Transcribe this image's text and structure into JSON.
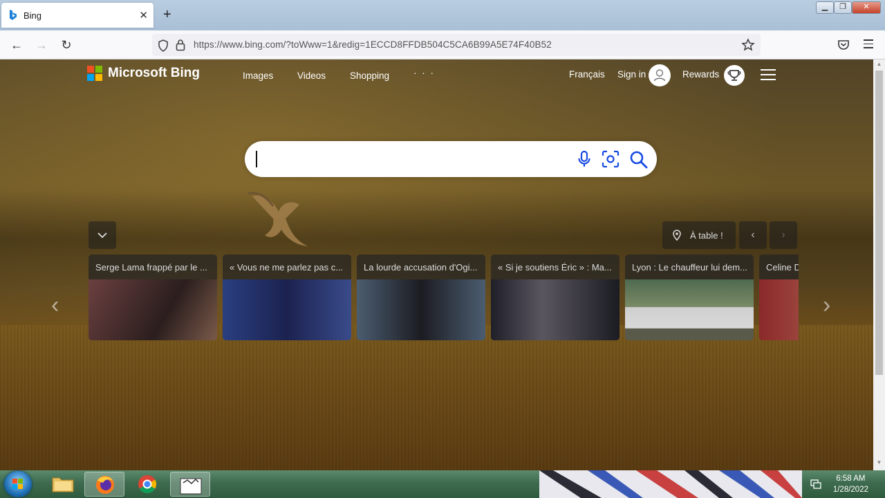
{
  "browser": {
    "tab_title": "Bing",
    "address": "https://www.bing.com/?toWww=1&redig=1ECCD8FFDB504C5CA6B99A5E74F40B52"
  },
  "bing": {
    "logo_text": "Microsoft Bing",
    "nav": [
      "Images",
      "Videos",
      "Shopping",
      "· · ·"
    ],
    "language": "Français",
    "sign_in": "Sign in",
    "rewards": "Rewards",
    "search_placeholder": ""
  },
  "carousel": {
    "location_label": "À table !",
    "cards": [
      {
        "title": "Serge Lama frappé par le ...",
        "color": "#5a3a3a"
      },
      {
        "title": "« Vous ne me parlez pas c...",
        "color": "#2c3e74"
      },
      {
        "title": "La lourde accusation d'Ogi...",
        "color": "#4d5a68"
      },
      {
        "title": "« Si je soutiens Éric » : Ma...",
        "color": "#2b2b33"
      },
      {
        "title": "Lyon : Le chauffeur lui dem...",
        "color": "#6d7a58"
      },
      {
        "title": "Celine D",
        "color": "#6b2b2b"
      }
    ]
  },
  "taskbar": {
    "time": "6:58 AM",
    "date": "1/28/2022"
  },
  "colors": {
    "ms_red": "#f25022",
    "ms_green": "#7fba00",
    "ms_blue": "#00a4ef",
    "ms_yellow": "#ffb900"
  }
}
